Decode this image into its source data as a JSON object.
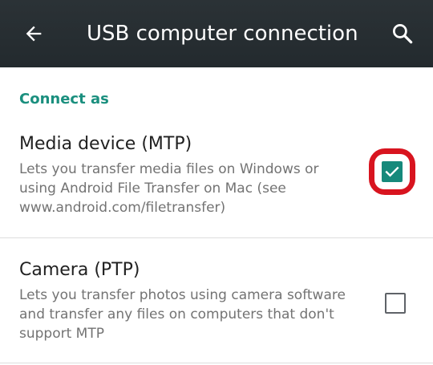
{
  "appbar": {
    "title": "USB computer connection",
    "back_icon": "arrow-back-icon",
    "search_icon": "search-icon",
    "background": "#263238"
  },
  "section": {
    "header": "Connect as",
    "accent": "#1a8f7e"
  },
  "options": [
    {
      "title": "Media device (MTP)",
      "description": "Lets you transfer media files on Windows or using Android File Transfer on Mac (see www.android.com/filetransfer)",
      "checked": true
    },
    {
      "title": "Camera (PTP)",
      "description": "Lets you transfer photos using camera software and transfer any files on computers that don't support MTP",
      "checked": false
    }
  ],
  "colors": {
    "checkbox_checked": "#16897b",
    "highlight_ring": "#d8141f"
  }
}
